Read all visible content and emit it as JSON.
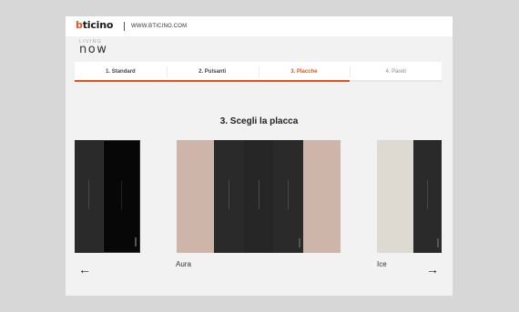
{
  "header": {
    "logo_prefix": "b",
    "logo_rest": "ticino",
    "url": "WWW.BTICINO.COM"
  },
  "brand": {
    "line1": "LIVING",
    "line2": "now"
  },
  "steps": [
    {
      "label": "1. Standard",
      "state": "done"
    },
    {
      "label": "2. Pulsanti",
      "state": "done"
    },
    {
      "label": "3. Placche",
      "state": "active"
    },
    {
      "label": "4. Pareti",
      "state": "todo"
    }
  ],
  "main": {
    "heading": "3. Scegli la placca"
  },
  "plates": {
    "labels": [
      "Aura",
      "Ice"
    ]
  },
  "nav": {
    "prev_icon": "arrow-left-icon",
    "next_icon": "arrow-right-icon",
    "prev_glyph": "←",
    "next_glyph": "→"
  },
  "colors": {
    "accent": "#e2531e",
    "dark_module": "#2a2a2a",
    "aura": "#cdb5aa",
    "ice": "#dedad1"
  }
}
